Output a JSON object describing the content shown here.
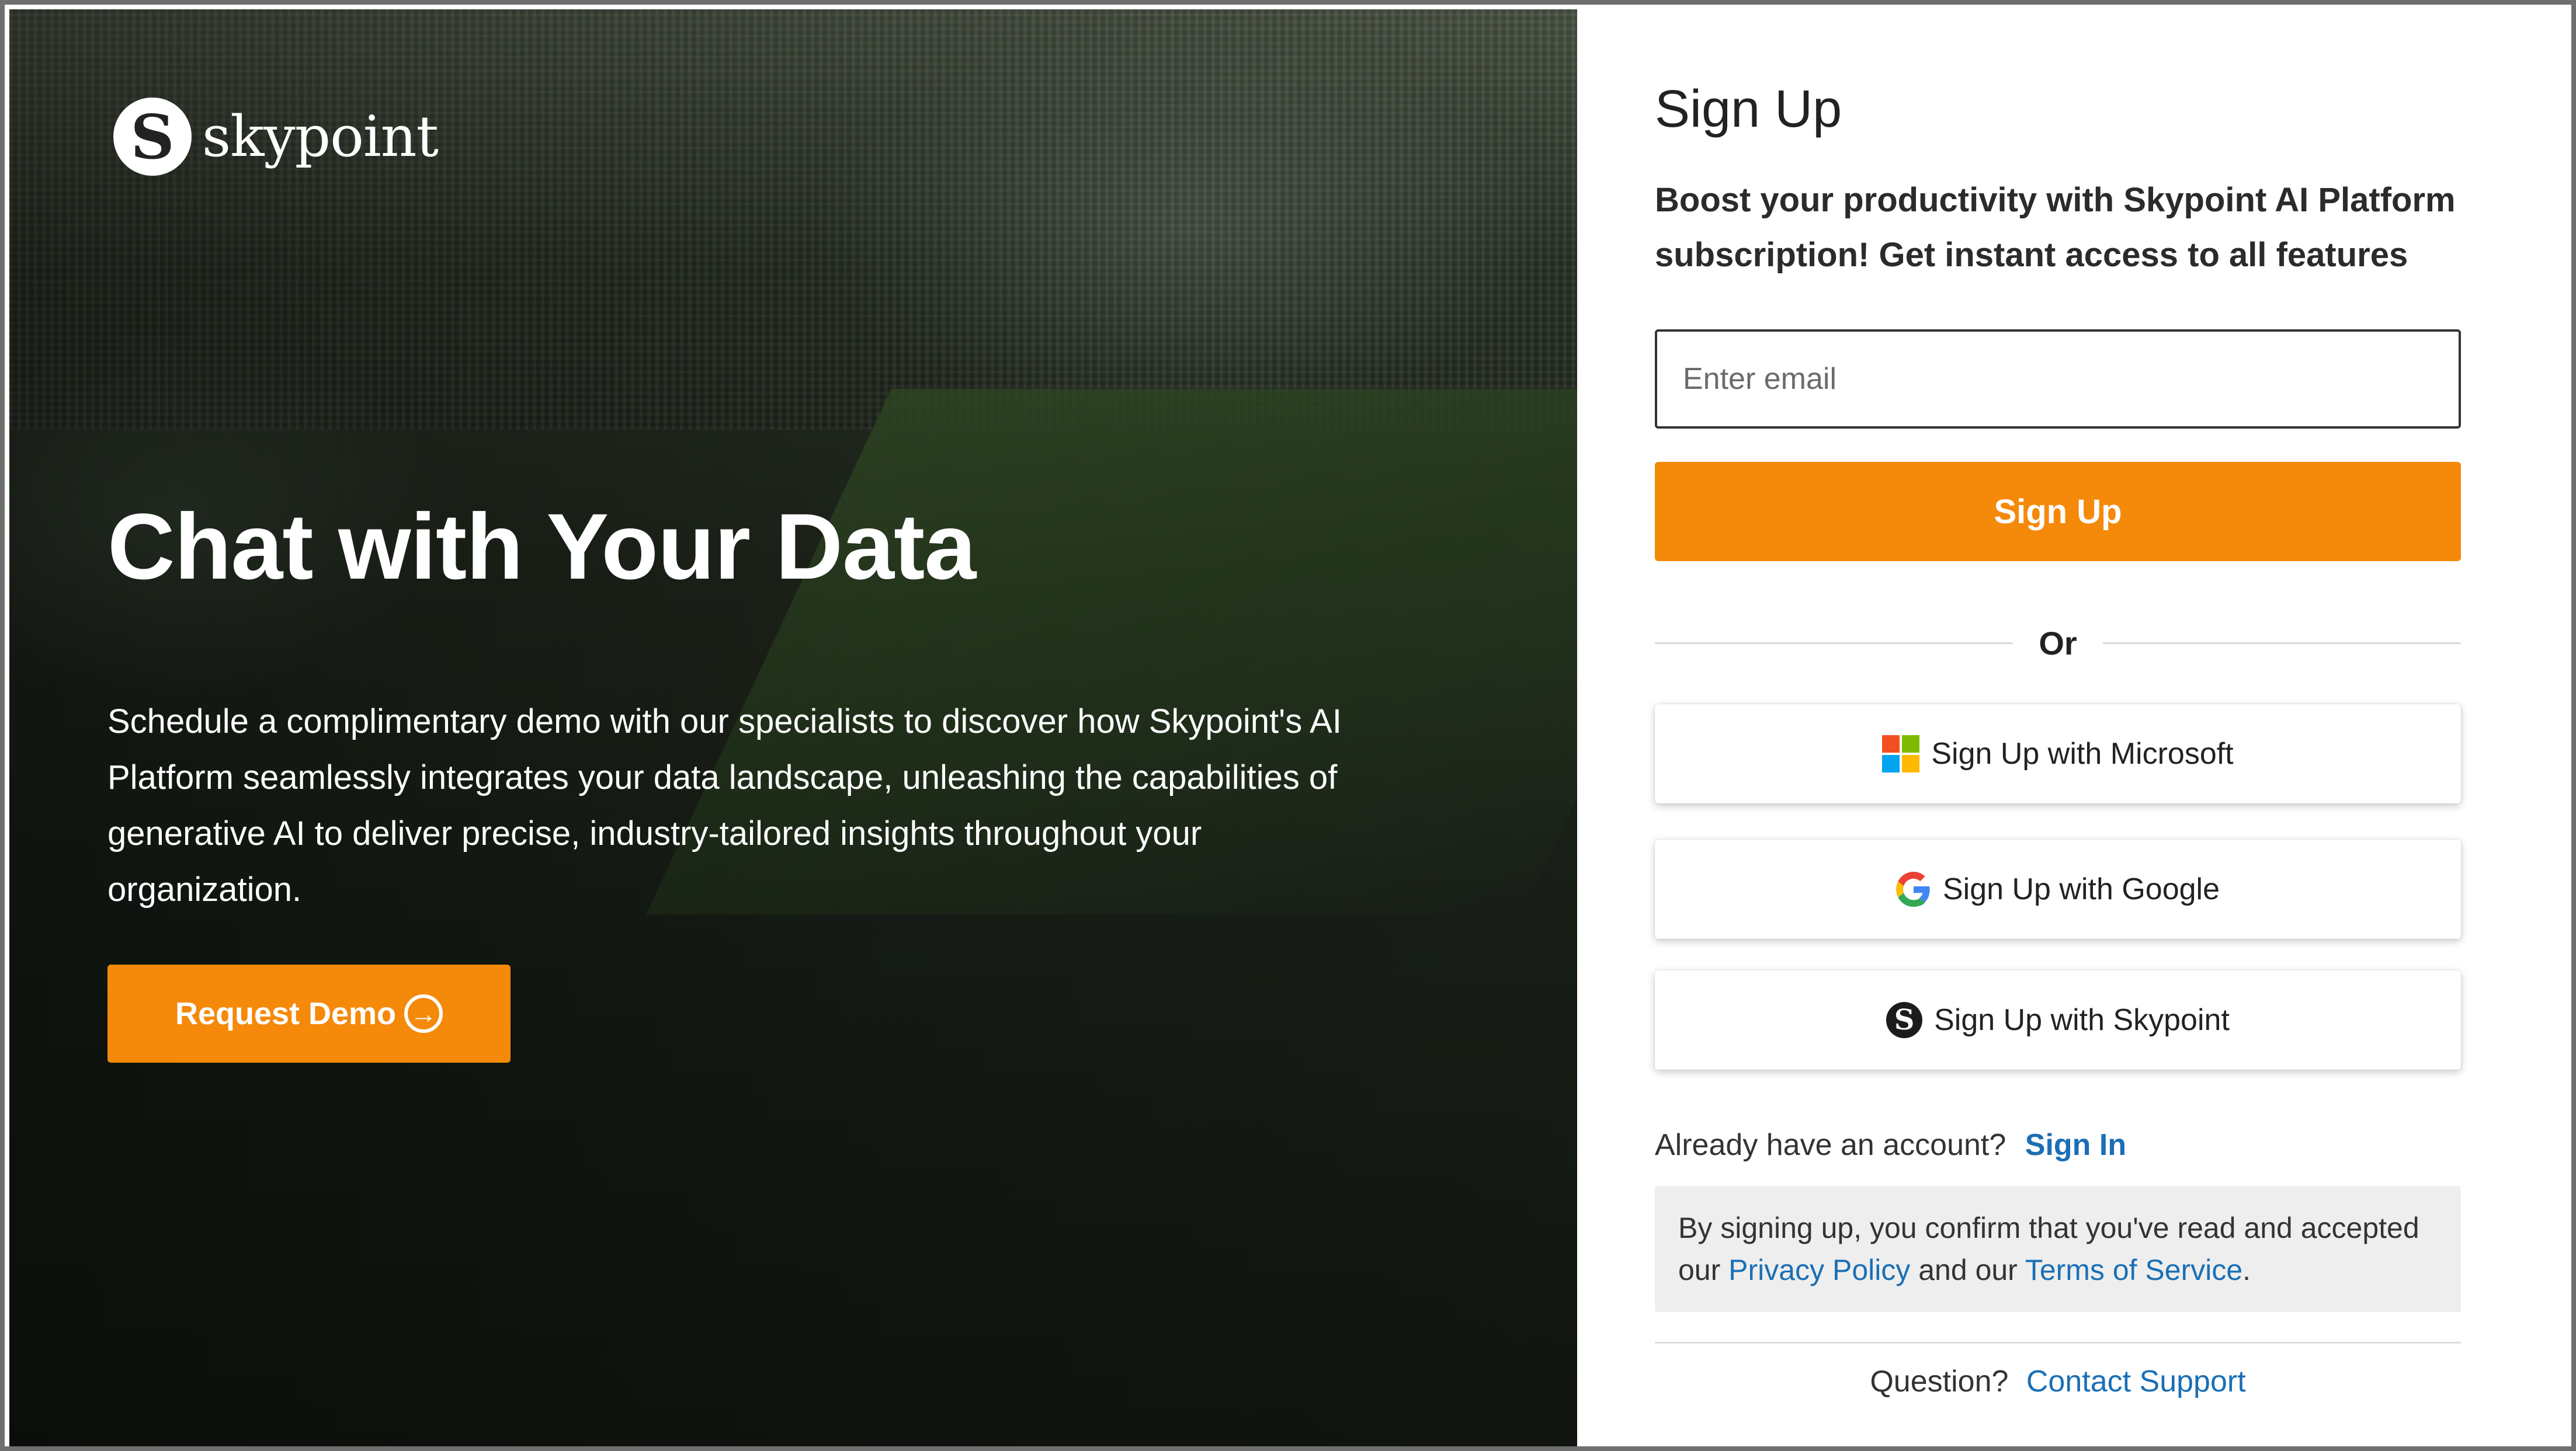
{
  "brand": {
    "name": "skypoint",
    "mark": "S"
  },
  "hero": {
    "title": "Chat with Your Data",
    "description": "Schedule a complimentary demo with our specialists to discover how Skypoint's AI Platform seamlessly integrates your data landscape, unleashing the capabilities of generative AI to deliver precise, industry-tailored insights throughout your organization.",
    "demo_button": "Request Demo",
    "demo_icon": "arrow-circle-right-icon"
  },
  "signup": {
    "title": "Sign Up",
    "subtitle": "Boost your productivity with Skypoint AI Platform subscription! Get instant access to all features",
    "email_placeholder": "Enter email",
    "submit_label": "Sign Up",
    "or_label": "Or",
    "sso": [
      {
        "label": "Sign Up with Microsoft",
        "icon": "microsoft-icon"
      },
      {
        "label": "Sign Up with Google",
        "icon": "google-icon"
      },
      {
        "label": "Sign Up with Skypoint",
        "icon": "skypoint-icon"
      }
    ],
    "already_text": "Already have an account?",
    "signin_link": "Sign In",
    "terms": {
      "prefix": "By signing up, you confirm that you've read and accepted our ",
      "privacy": "Privacy Policy",
      "middle": " and our ",
      "tos": "Terms of Service",
      "suffix": "."
    },
    "question_text": "Question?",
    "support_link": "Contact Support"
  },
  "colors": {
    "accent": "#f5890a",
    "link": "#1a6fb5"
  }
}
